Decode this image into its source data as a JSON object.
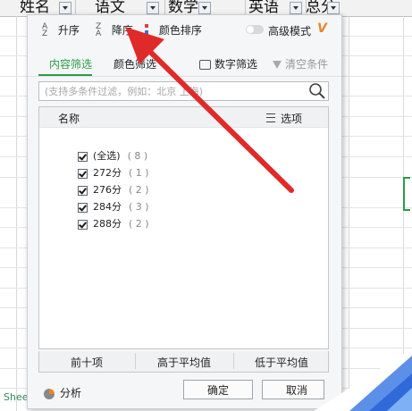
{
  "sheet": {
    "headers": [
      {
        "label": "姓名"
      },
      {
        "label": "语文"
      },
      {
        "label": "数学"
      },
      {
        "label": "英语"
      },
      {
        "label": "总分"
      }
    ],
    "tab_label": "Shee"
  },
  "filter_panel": {
    "sort": {
      "asc_label": "升序",
      "desc_label": "降序",
      "color_label": "颜色排序"
    },
    "advanced_mode_label": "高级模式",
    "advanced_icon": "V",
    "tabs": {
      "content": "内容筛选",
      "color": "颜色筛选"
    },
    "number_filter_label": "数字筛选",
    "clear_filter_label": "清空条件",
    "search": {
      "placeholder": "(支持多条件过滤，例如：北京 上海)"
    },
    "list": {
      "name_header": "名称",
      "options_label": "选项",
      "items": [
        {
          "label": "(全选)",
          "count": "( 8 )"
        },
        {
          "label": "272分",
          "count": "( 1 )"
        },
        {
          "label": "276分",
          "count": "( 2 )"
        },
        {
          "label": "284分",
          "count": "( 3 )"
        },
        {
          "label": "288分",
          "count": "( 2 )"
        }
      ]
    },
    "quick": {
      "top10": "前十项",
      "above_avg": "高于平均值",
      "below_avg": "低于平均值"
    },
    "analysis_label": "分析",
    "ok_label": "确定",
    "cancel_label": "取消"
  },
  "colors": {
    "accent": "#2e9b46",
    "arrow": "#e02a2a",
    "decor_blue": "#4a84e6"
  }
}
